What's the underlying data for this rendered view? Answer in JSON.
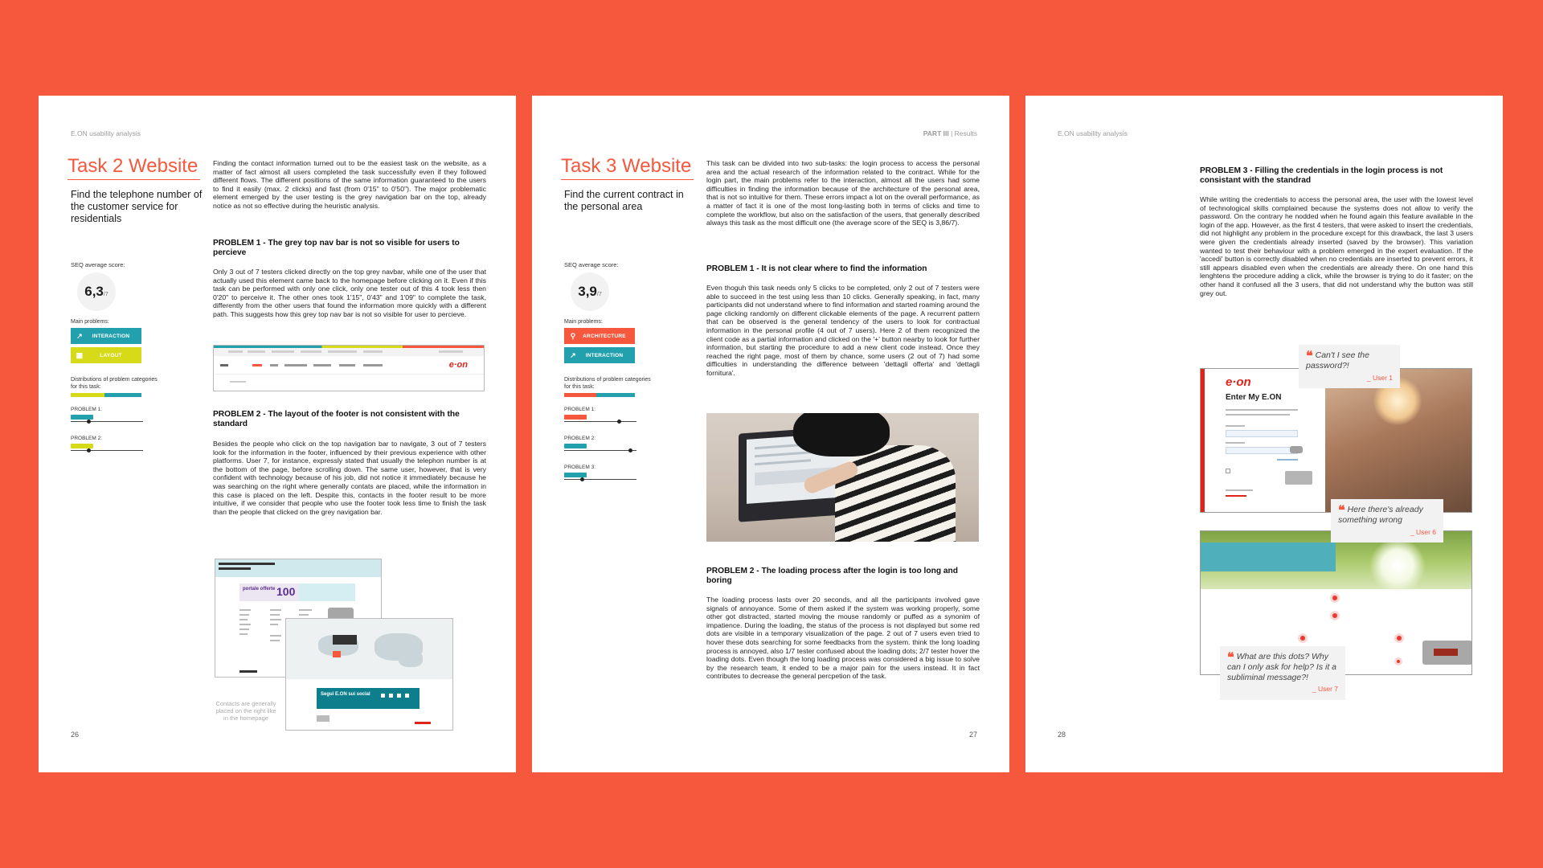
{
  "page26": {
    "header": "E.ON usability analysis",
    "title": "Task 2 Website",
    "subtitle": "Find the telephone number of the customer service for residentials",
    "intro": "Finding the contact information turned out to be the easiest task on the website, as a matter of fact almost all users completed the task successfully even if they followed different flows. The different positions of the same information guaranteed to the users to find it easily (max. 2 clicks) and fast (from 0'15\" to 0'50\"). The major problematic element emerged by the user testing is the grey navigation bar on the top, already notice as not so effective during the heuristic analysis.",
    "seq_label": "SEQ average score:",
    "seq_value": "6,3",
    "seq_scale": "/7",
    "main_problems_label": "Main problems:",
    "tags": [
      "INTERACTION",
      "LAYOUT"
    ],
    "distribution_label": "Distributions of problem categories for this task:",
    "problem1_label": "PROBLEM 1:",
    "problem2_label": "PROBLEM 2:",
    "problem1_title": "PROBLEM 1 - The grey top nav bar is not so visible for users to percieve",
    "problem1_text": "Only 3 out of 7 testers clicked directly on the top grey navbar, while one of the user that actually used this element came back to the homepage before clicking on it. Even if this task can be performed with only one click, only one tester out of this 4 took less then 0'20\" to perceive it. The other ones took 1'15\", 0'43\" and 1'09\" to complete the task, differently from the other users that found the information more quickly with a different path. This suggests how this grey top nav bar is not so visible for user to percieve.",
    "problem2_title": "PROBLEM 2 - The layout of the footer is not consistent with the standard",
    "problem2_text": "Besides the people who click on the top navigation bar to navigate, 3 out of 7 testers look for the information in the footer, influenced by their previous experience with other platforms. User 7, for instance, expressly stated that usually the telephon number is at the bottom of the page, before scrolling down. The same user, however, that is very confident with technology because of his job, did not notice it immediately because he was searching on the right where generally contats are placed, while the information in this case is placed on the left. Despite this, contacts in the footer result to be more intuitive, if we consider that people who use the footer took less time to finish the task than the people that clicked on the grey navigation bar.",
    "nav_logo": "e·on",
    "promo_text": "portale offerte",
    "promo_number": "100",
    "social_band": "Segui E.ON sui social",
    "caption": "Contacts are generally placed on the right like in the homepage",
    "page_number": "26"
  },
  "page27": {
    "header_part": "PART III",
    "header_section": "Results",
    "title": "Task 3 Website",
    "subtitle": "Find the current contract in the personal area",
    "intro": "This task can be divided into two sub-tasks: the login process to access the personal area and the actual research of the information related to the contract. While for the login part, the main problems refer to the interaction, almost all the users had some difficulties in finding the information because of the architecture of the personal area, that is not so intuitive for them. These errors impact a lot on the overall performance, as a matter of fact it is one of the most long-lasting both in terms of clicks and time to complete the workflow, but also on the satisfaction of the users, that generally described always this task as the most difficult one (the average score of the SEQ is 3,86/7).",
    "seq_label": "SEQ average score:",
    "seq_value": "3,9",
    "seq_scale": "/7",
    "main_problems_label": "Main problems:",
    "tags": [
      "ARCHITECTURE",
      "INTERACTION"
    ],
    "distribution_label": "Distributions of problem categories for this task:",
    "problem1_label": "PROBLEM 1:",
    "problem2_label": "PROBLEM 2:",
    "problem3_label": "PROBLEM 3:",
    "problem1_title": "PROBLEM 1 - It is not clear where to find the information",
    "problem1_text": "Even thoguh this task needs only 5 clicks to be completed, only 2 out of 7 testers were able to succeed in the test using less than 10 clicks. Generally speaking, in fact, many participants did not understand where to find information and started roaming around the page clicking randomly on different clickable elements of the page. A recurrent pattern that can be observed is the general tendency of the users to look for contractual information in the personal profile (4 out of 7 users). Here 2 of them recognized the client code as a partial information and clicked on the '+' button nearby to look for further information, but starting the procedure to add a new client code instead. Once they reached the right page, most of them by chance, some users (2 out of 7) had some difficulties in understanding the difference between 'dettagli offerta' and 'dettagli fornitura'.",
    "problem2_title": "PROBLEM 2 - The loading process after the login is too long and boring",
    "problem2_text": "The loading process lasts over 20 seconds, and all the participants involved gave signals of annoyance. Some of them asked if the system was working properly, some other got distracted, started moving the mouse randomly or puffed as a synonim of impatience. During the loading, the status of the process is not displayed but some red dots are visible in a temporary visualization of the page. 2 out of 7 users even tried to hover these dots searching for some feedbacks from the system.  think the long loading process is annoyed, also 1/7 tester confused about the loading dots; 2/7 tester hover the loading dots. Even though the long loading process was considered a big issue to solve by the research team, it ended to be a major pain for the users instead. It in fact contributes to decrease the general percpetion of the task.",
    "page_number": "27"
  },
  "page28": {
    "header": "E.ON usability analysis",
    "problem3_title": "PROBLEM 3 - Filling the credentials in the login process is not consistant with the standrad",
    "problem3_text": "While writing the credentials to access the personal area, the user with the lowest level of technological skills complained because the systems does not allow to verify the password. On the contrary he nodded when he found again this feature available in the login of the app. However, as the first 4 testers, that were asked to insert the credentials, did not highlight any problem in the procedure except for this drawback, the last 3 users were given the credentials already inserted (saved by the browser). This variation wanted to test their behaviour with a problem emerged in the expert evaluation. If the 'accedi' button is correctly disabled when no credentials are inserted to prevent errors, it still appears disabled even when the credentials are already there. On one hand this lenghtens the procedure adding a click, while the browser is trying to do it faster; on the other hand it confused all the 3 users, that did not understand why the button was still grey out.",
    "login_logo": "e·on",
    "login_title": "Enter My E.ON",
    "quotes": [
      {
        "text": "Can't I see the password?!",
        "who": "_ User 1"
      },
      {
        "text": "Here there's already something wrong",
        "who": "_ User 6"
      },
      {
        "text": "What are this dots? Why can I only ask for help? Is it a subliminal message?!",
        "who": "_ User 7"
      }
    ],
    "page_number": "28"
  },
  "colors": {
    "background": "#f5583d",
    "teal": "#22a0ad",
    "yellow": "#d7da19",
    "accent": "#f5583d"
  }
}
